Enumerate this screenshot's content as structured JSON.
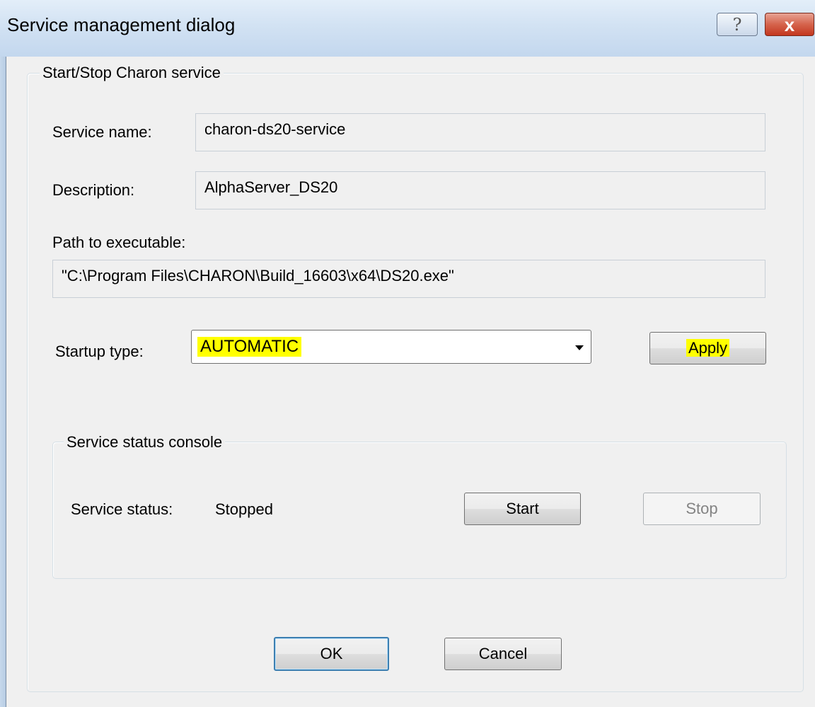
{
  "window": {
    "title": "Service management dialog",
    "help_label": "?",
    "close_label": "x"
  },
  "group_main": {
    "legend": "Start/Stop Charon service",
    "service_name_label": "Service name:",
    "service_name_value": "charon-ds20-service",
    "description_label": "Description:",
    "description_value": "AlphaServer_DS20",
    "path_label": "Path to executable:",
    "path_value": "\"C:\\Program Files\\CHARON\\Build_16603\\x64\\DS20.exe\"",
    "startup_label": "Startup type:",
    "startup_value": "AUTOMATIC",
    "apply_label": "Apply"
  },
  "group_status": {
    "legend": "Service status console",
    "status_label": "Service status:",
    "status_value": "Stopped",
    "start_label": "Start",
    "stop_label": "Stop"
  },
  "footer": {
    "ok_label": "OK",
    "cancel_label": "Cancel"
  },
  "colors": {
    "highlight": "#ffff00",
    "dialog_bg": "#f0f0f0",
    "close_button": "#c3371f"
  }
}
